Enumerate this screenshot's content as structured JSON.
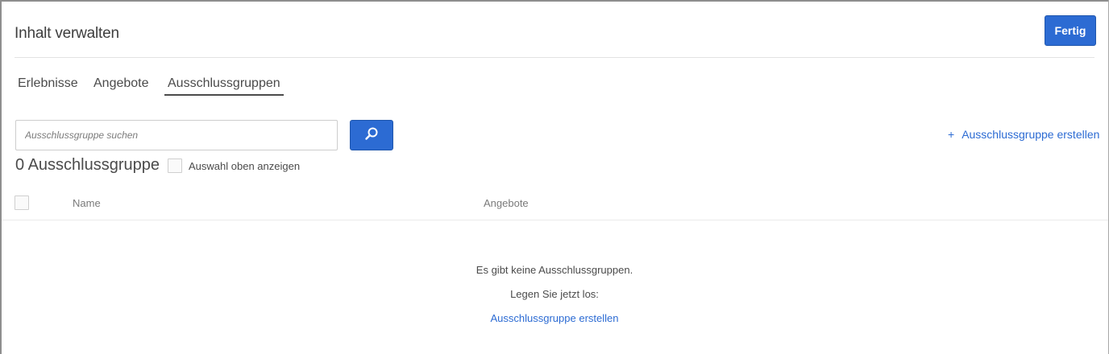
{
  "header": {
    "title": "Inhalt verwalten",
    "done_label": "Fertig"
  },
  "tabs": [
    {
      "label": "Erlebnisse",
      "active": false
    },
    {
      "label": "Angebote",
      "active": false
    },
    {
      "label": "Ausschlussgruppen",
      "active": true
    }
  ],
  "search": {
    "placeholder": "Ausschlussgruppe suchen",
    "value": "",
    "button_icon": "search-icon"
  },
  "create": {
    "plus": "+",
    "label": "Ausschlussgruppe erstellen"
  },
  "summary": {
    "count_text": "0 Ausschlussgruppe",
    "show_selected_label": "Auswahl oben anzeigen"
  },
  "table": {
    "columns": [
      "Name",
      "Angebote"
    ],
    "rows": []
  },
  "empty_state": {
    "message": "Es gibt keine Ausschlussgruppen.",
    "prompt": "Legen Sie jetzt los:",
    "link_label": "Ausschlussgruppe erstellen"
  },
  "colors": {
    "accent": "#2c6bd3",
    "text": "#4b4b4b",
    "muted": "#7a7a7a"
  }
}
